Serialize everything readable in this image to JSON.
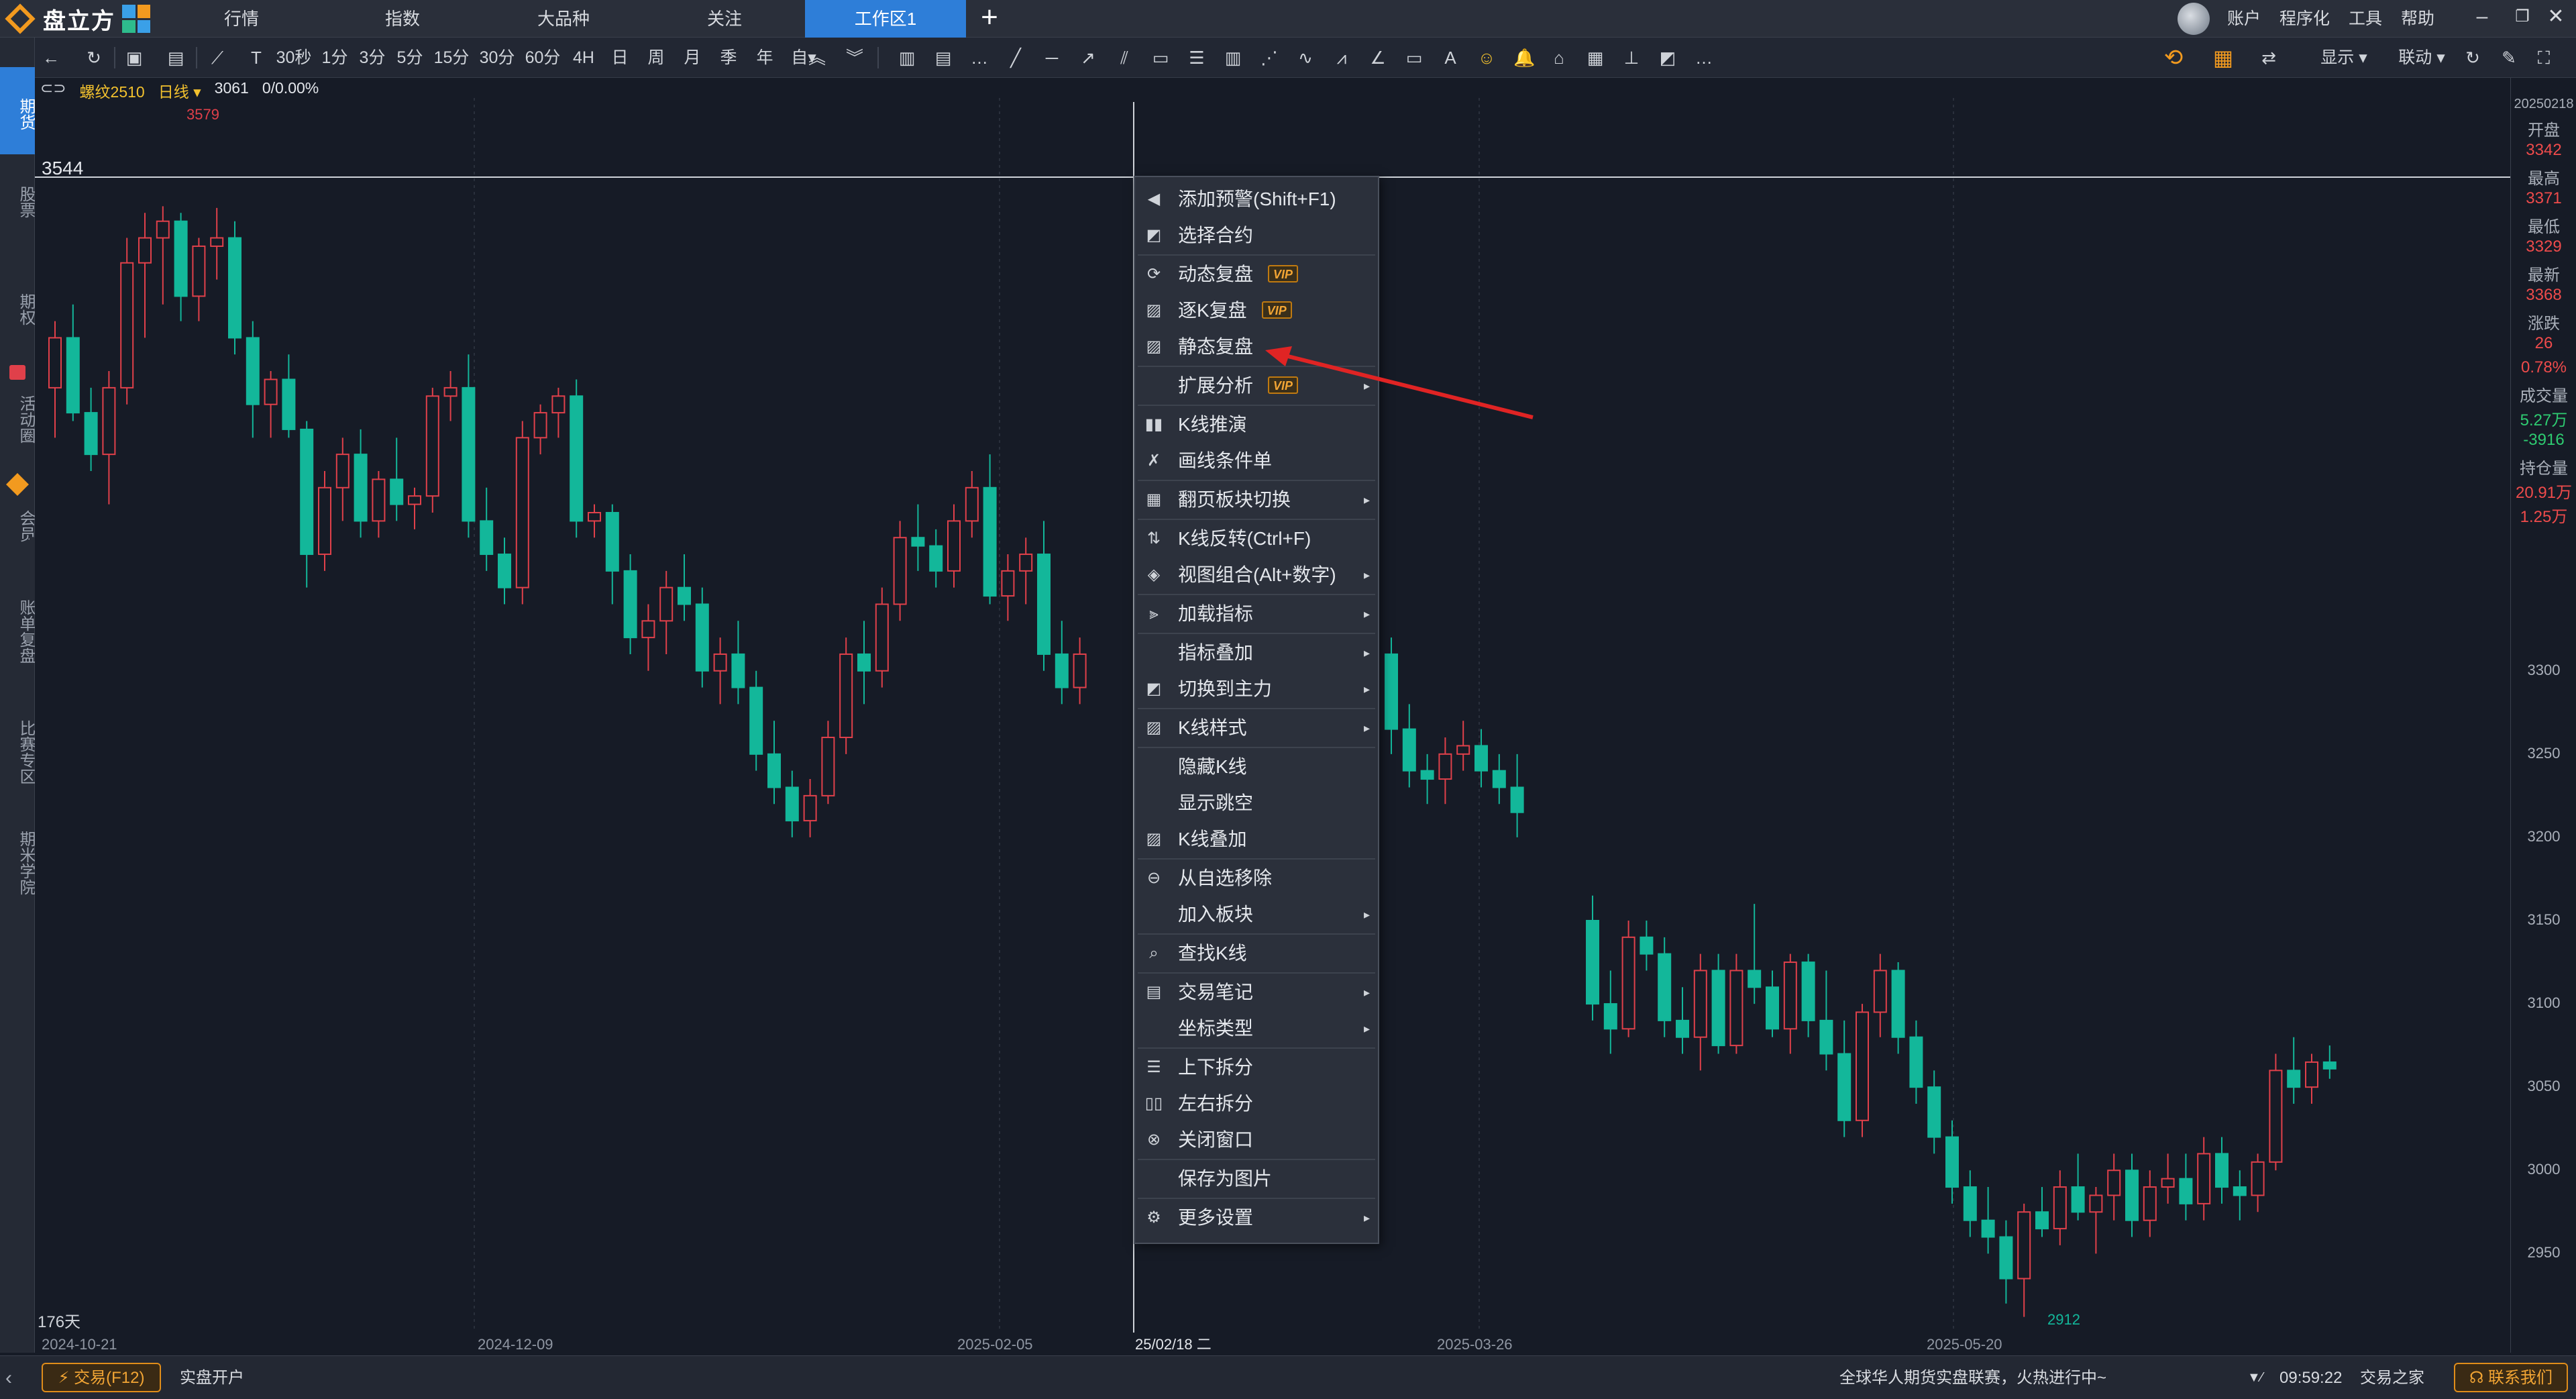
{
  "app": {
    "name": "盘立方"
  },
  "nav": {
    "tabs": [
      "行情",
      "指数",
      "大品种",
      "关注",
      "工作区1"
    ],
    "active_tab": "工作区1"
  },
  "top_menu": [
    "账户",
    "程序化",
    "工具",
    "帮助"
  ],
  "toolbar": {
    "periods": [
      "30秒",
      "1分",
      "3分",
      "5分",
      "15分",
      "30分",
      "60分",
      "4H",
      "日",
      "周",
      "月",
      "季",
      "年",
      "自▾"
    ],
    "right_labels": {
      "display": "显示 ▾",
      "link": "联动 ▾"
    }
  },
  "sidebar": {
    "items": [
      "期货",
      "股票",
      "期权",
      "活动圈",
      "会员",
      "账单复盘",
      "比赛专区",
      "期米学院"
    ]
  },
  "chart_header": {
    "symbol": "螺纹2510",
    "period": "日线 ▾",
    "price": "3061",
    "change": "0/0.00%"
  },
  "chart_data": {
    "type": "candlestick",
    "crosshair_price_label": "3544",
    "high_label": "3579",
    "low_label": "2912",
    "days_label": "176天",
    "x_ticks": [
      "2024-10-21",
      "2024-12-09",
      "2025-02-05",
      "25/02/18 二",
      "2025-03-26",
      "2025-05-20"
    ],
    "y_ticks": [
      "3300",
      "3250",
      "3200",
      "3150",
      "3100",
      "3050",
      "3000",
      "2950"
    ],
    "y_range": [
      2905,
      3640
    ],
    "colors": {
      "up": "#e0404a",
      "down": "#13b79a",
      "bg": "#161b26",
      "grid": "#2a303c"
    },
    "candles_ohlc": [
      [
        3470,
        3510,
        3440,
        3500
      ],
      [
        3500,
        3520,
        3450,
        3455
      ],
      [
        3455,
        3470,
        3420,
        3430
      ],
      [
        3430,
        3480,
        3400,
        3470
      ],
      [
        3470,
        3560,
        3460,
        3545
      ],
      [
        3545,
        3575,
        3500,
        3560
      ],
      [
        3560,
        3579,
        3520,
        3570
      ],
      [
        3570,
        3575,
        3510,
        3525
      ],
      [
        3525,
        3560,
        3510,
        3555
      ],
      [
        3555,
        3578,
        3535,
        3560
      ],
      [
        3560,
        3570,
        3490,
        3500
      ],
      [
        3500,
        3510,
        3440,
        3460
      ],
      [
        3460,
        3480,
        3440,
        3475
      ],
      [
        3475,
        3490,
        3440,
        3445
      ],
      [
        3445,
        3450,
        3350,
        3370
      ],
      [
        3370,
        3420,
        3360,
        3410
      ],
      [
        3410,
        3440,
        3390,
        3430
      ],
      [
        3430,
        3445,
        3380,
        3390
      ],
      [
        3390,
        3420,
        3380,
        3415
      ],
      [
        3415,
        3440,
        3390,
        3400
      ],
      [
        3400,
        3410,
        3385,
        3405
      ],
      [
        3405,
        3470,
        3395,
        3465
      ],
      [
        3465,
        3480,
        3450,
        3470
      ],
      [
        3470,
        3490,
        3380,
        3390
      ],
      [
        3390,
        3410,
        3360,
        3370
      ],
      [
        3370,
        3380,
        3340,
        3350
      ],
      [
        3350,
        3450,
        3340,
        3440
      ],
      [
        3440,
        3460,
        3430,
        3455
      ],
      [
        3455,
        3470,
        3440,
        3465
      ],
      [
        3465,
        3475,
        3380,
        3390
      ],
      [
        3390,
        3400,
        3380,
        3395
      ],
      [
        3395,
        3400,
        3340,
        3360
      ],
      [
        3360,
        3370,
        3310,
        3320
      ],
      [
        3320,
        3340,
        3300,
        3330
      ],
      [
        3330,
        3360,
        3310,
        3350
      ],
      [
        3350,
        3370,
        3330,
        3340
      ],
      [
        3340,
        3350,
        3290,
        3300
      ],
      [
        3300,
        3320,
        3280,
        3310
      ],
      [
        3310,
        3330,
        3280,
        3290
      ],
      [
        3290,
        3300,
        3240,
        3250
      ],
      [
        3250,
        3270,
        3220,
        3230
      ],
      [
        3230,
        3240,
        3200,
        3210
      ],
      [
        3210,
        3235,
        3200,
        3225
      ],
      [
        3225,
        3270,
        3220,
        3260
      ],
      [
        3260,
        3320,
        3250,
        3310
      ],
      [
        3310,
        3330,
        3280,
        3300
      ],
      [
        3300,
        3350,
        3290,
        3340
      ],
      [
        3340,
        3390,
        3330,
        3380
      ],
      [
        3380,
        3400,
        3360,
        3375
      ],
      [
        3375,
        3385,
        3350,
        3360
      ],
      [
        3360,
        3400,
        3350,
        3390
      ],
      [
        3390,
        3420,
        3380,
        3410
      ],
      [
        3410,
        3430,
        3340,
        3345
      ],
      [
        3345,
        3370,
        3330,
        3360
      ],
      [
        3360,
        3380,
        3340,
        3370
      ],
      [
        3370,
        3390,
        3300,
        3310
      ],
      [
        3310,
        3330,
        3280,
        3290
      ],
      [
        3290,
        3320,
        3280,
        3310
      ]
    ],
    "candles_ohlc_after": [
      [
        3310,
        3320,
        3250,
        3265
      ],
      [
        3265,
        3280,
        3230,
        3240
      ],
      [
        3240,
        3250,
        3220,
        3235
      ],
      [
        3235,
        3260,
        3220,
        3250
      ],
      [
        3250,
        3270,
        3240,
        3255
      ],
      [
        3255,
        3265,
        3230,
        3240
      ],
      [
        3240,
        3250,
        3220,
        3230
      ],
      [
        3230,
        3250,
        3200,
        3215
      ],
      [
        3150,
        3165,
        3090,
        3100
      ],
      [
        3100,
        3120,
        3070,
        3085
      ],
      [
        3085,
        3150,
        3080,
        3140
      ],
      [
        3140,
        3150,
        3120,
        3130
      ],
      [
        3130,
        3140,
        3080,
        3090
      ],
      [
        3090,
        3110,
        3070,
        3080
      ],
      [
        3080,
        3130,
        3060,
        3120
      ],
      [
        3120,
        3130,
        3070,
        3075
      ],
      [
        3075,
        3130,
        3070,
        3120
      ],
      [
        3120,
        3160,
        3100,
        3110
      ],
      [
        3110,
        3120,
        3080,
        3085
      ],
      [
        3085,
        3130,
        3070,
        3125
      ],
      [
        3125,
        3130,
        3080,
        3090
      ],
      [
        3090,
        3120,
        3060,
        3070
      ],
      [
        3070,
        3090,
        3020,
        3030
      ],
      [
        3030,
        3100,
        3020,
        3095
      ],
      [
        3095,
        3130,
        3080,
        3120
      ],
      [
        3120,
        3125,
        3070,
        3080
      ],
      [
        3080,
        3090,
        3040,
        3050
      ],
      [
        3050,
        3060,
        3010,
        3020
      ],
      [
        3020,
        3030,
        2980,
        2990
      ],
      [
        2990,
        3000,
        2960,
        2970
      ],
      [
        2970,
        2990,
        2950,
        2960
      ],
      [
        2960,
        2970,
        2920,
        2935
      ],
      [
        2935,
        2980,
        2912,
        2975
      ],
      [
        2975,
        2990,
        2960,
        2965
      ],
      [
        2965,
        3000,
        2955,
        2990
      ],
      [
        2990,
        3010,
        2970,
        2975
      ],
      [
        2975,
        2990,
        2950,
        2985
      ],
      [
        2985,
        3010,
        2970,
        3000
      ],
      [
        3000,
        3010,
        2960,
        2970
      ],
      [
        2970,
        3000,
        2960,
        2990
      ],
      [
        2990,
        3010,
        2980,
        2995
      ],
      [
        2995,
        3010,
        2970,
        2980
      ],
      [
        2980,
        3020,
        2970,
        3010
      ],
      [
        3010,
        3020,
        2980,
        2990
      ],
      [
        2990,
        3000,
        2970,
        2985
      ],
      [
        2985,
        3010,
        2975,
        3005
      ],
      [
        3005,
        3070,
        3000,
        3060
      ],
      [
        3060,
        3080,
        3040,
        3050
      ],
      [
        3050,
        3070,
        3040,
        3065
      ],
      [
        3065,
        3075,
        3055,
        3061
      ]
    ]
  },
  "info_panel": {
    "date": "20250218",
    "open_label": "开盘",
    "open": "3342",
    "high_label": "最高",
    "high": "3371",
    "low_label": "最低",
    "low": "3329",
    "last_label": "最新",
    "last": "3368",
    "chg_label": "涨跌",
    "chg": "26",
    "chg_pct": "0.78%",
    "vol_label": "成交量",
    "vol": "5.27万",
    "vol_chg": "-3916",
    "oi_label": "持仓量",
    "oi": "20.91万",
    "oi_chg": "1.25万"
  },
  "context_menu": {
    "items": [
      {
        "label": "添加预警(Shift+F1)",
        "icon": "speaker-icon"
      },
      {
        "label": "选择合约",
        "icon": "select-icon"
      },
      {
        "label": "动态复盘",
        "icon": "replay-icon",
        "vip": true
      },
      {
        "label": "逐K复盘",
        "icon": "kline-replay-icon",
        "vip": true
      },
      {
        "label": "静态复盘",
        "icon": "static-replay-icon"
      },
      {
        "label": "扩展分析",
        "vip": true,
        "submenu": true
      },
      {
        "label": "K线推演",
        "icon": "kline-deduce-icon"
      },
      {
        "label": "画线条件单",
        "icon": "draw-order-icon"
      },
      {
        "label": "翻页板块切换",
        "icon": "grid-icon",
        "submenu": true
      },
      {
        "label": "K线反转(Ctrl+F)",
        "icon": "flip-icon"
      },
      {
        "label": "视图组合(Alt+数字)",
        "icon": "cube-icon",
        "submenu": true
      },
      {
        "label": "加载指标",
        "icon": "indicator-icon",
        "submenu": true
      },
      {
        "label": "指标叠加",
        "submenu": true
      },
      {
        "label": "切换到主力",
        "icon": "switch-icon",
        "submenu": true
      },
      {
        "label": "K线样式",
        "icon": "kline-style-icon",
        "submenu": true
      },
      {
        "label": "隐藏K线"
      },
      {
        "label": "显示跳空"
      },
      {
        "label": "K线叠加",
        "icon": "kline-overlay-icon"
      },
      {
        "label": "从自选移除",
        "icon": "minus-circle-icon"
      },
      {
        "label": "加入板块",
        "submenu": true
      },
      {
        "label": "查找K线",
        "icon": "search-icon"
      },
      {
        "label": "交易笔记",
        "icon": "note-icon",
        "submenu": true
      },
      {
        "label": "坐标类型",
        "submenu": true
      },
      {
        "label": "上下拆分",
        "icon": "split-v-icon"
      },
      {
        "label": "左右拆分",
        "icon": "split-h-icon"
      },
      {
        "label": "关闭窗口",
        "icon": "close-circle-icon"
      },
      {
        "label": "保存为图片"
      },
      {
        "label": "更多设置",
        "icon": "gear-icon",
        "submenu": true
      }
    ],
    "vip_label": "VIP"
  },
  "bottom": {
    "trade_btn": "交易(F12)",
    "open_account": "实盘开户",
    "ticker": "全球华人期货实盘联赛，火热进行中~",
    "time": "09:59:22",
    "trade_home": "交易之家",
    "contact": "联系我们"
  }
}
